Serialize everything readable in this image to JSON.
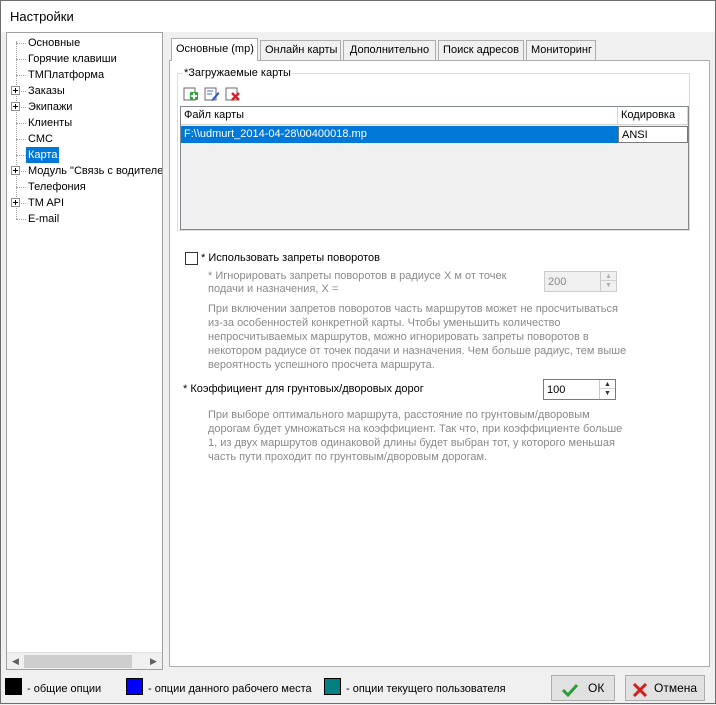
{
  "window": {
    "title": "Настройки"
  },
  "tree": {
    "items": [
      {
        "label": "Основные",
        "expandable": false,
        "selected": false
      },
      {
        "label": "Горячие клавиши",
        "expandable": false,
        "selected": false
      },
      {
        "label": "ТМПлатформа",
        "expandable": false,
        "selected": false
      },
      {
        "label": "Заказы",
        "expandable": true,
        "selected": false
      },
      {
        "label": "Экипажи",
        "expandable": true,
        "selected": false
      },
      {
        "label": "Клиенты",
        "expandable": false,
        "selected": false
      },
      {
        "label": "СМС",
        "expandable": false,
        "selected": false
      },
      {
        "label": "Карта",
        "expandable": false,
        "selected": true
      },
      {
        "label": "Модуль \"Связь с водителе",
        "expandable": true,
        "selected": false
      },
      {
        "label": "Телефония",
        "expandable": false,
        "selected": false
      },
      {
        "label": "TM API",
        "expandable": true,
        "selected": false
      },
      {
        "label": "E-mail",
        "expandable": false,
        "selected": false
      }
    ]
  },
  "tabs": [
    {
      "label": "Основные (mp)",
      "active": true
    },
    {
      "label": "Онлайн карты",
      "active": false
    },
    {
      "label": "Дополнительно",
      "active": false
    },
    {
      "label": "Поиск адресов",
      "active": false
    },
    {
      "label": "Мониторинг",
      "active": false
    }
  ],
  "maps_group": {
    "legend": "*Загружаемые карты",
    "toolbar": [
      "add-icon",
      "edit-icon",
      "delete-icon"
    ],
    "columns": [
      "Файл карты",
      "Кодировка"
    ],
    "rows": [
      {
        "file": "F:\\\\udmurt_2014-04-28\\00400018.mp",
        "encoding": "ANSI"
      }
    ]
  },
  "turn_restrictions": {
    "checkbox_label": "* Использовать запреты поворотов",
    "checked": false,
    "radius_label_line1": "* Игнорировать запреты поворотов в радиусе X м от точек",
    "radius_label_line2": "подачи  и назначения, X =",
    "radius_value": "200",
    "help_lines": [
      "При включении запретов поворотов часть маршрутов может не просчитываться",
      "из-за особенностей конкретной карты. Чтобы уменьшить количество",
      "непросчитываемых маршрутов, можно игнорировать запреты поворотов в",
      "некотором радиусе от точек подачи и назначения. Чем больше радиус, тем выше",
      "вероятность успешного просчета маршрута."
    ]
  },
  "coefficient": {
    "label": "* Коэффициент для грунтовых/дворовых дорог",
    "value": "100",
    "help_lines": [
      "При выборе оптимального маршрута, расстояние по грунтовым/дворовым",
      "дорогам будет умножаться на коэффициент. Так что, при коэффициенте больше",
      "1, из двух маршрутов одинаковой длины будет выбран тот, у которого меньшая",
      "часть пути проходит по грунтовым/дворовым дорогам."
    ]
  },
  "legend": [
    {
      "color": "#000000",
      "label": "- общие опции"
    },
    {
      "color": "#0000ff",
      "label": "- опции данного рабочего места"
    },
    {
      "color": "#008080",
      "label": "- опции текущего пользователя"
    }
  ],
  "buttons": {
    "ok": "ОК",
    "cancel": "Отмена"
  }
}
